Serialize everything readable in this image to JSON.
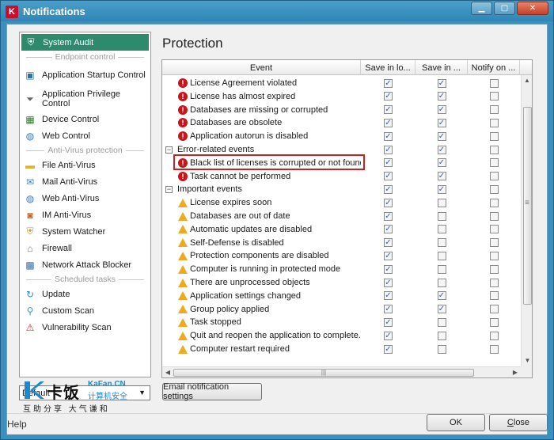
{
  "window": {
    "title": "Notifications",
    "controls": [
      "minimize",
      "maximize",
      "close"
    ]
  },
  "sidebar": {
    "items": [
      {
        "type": "item",
        "label": "System Audit",
        "icon": "shield-icon",
        "selected": true
      },
      {
        "type": "group",
        "label": "Endpoint control"
      },
      {
        "type": "item",
        "label": "Application Startup Control",
        "icon": "monitor-icon"
      },
      {
        "type": "item",
        "label": "Application Privilege Control",
        "icon": "filter-icon"
      },
      {
        "type": "item",
        "label": "Device Control",
        "icon": "chip-icon"
      },
      {
        "type": "item",
        "label": "Web Control",
        "icon": "globe-icon"
      },
      {
        "type": "group",
        "label": "Anti-Virus protection"
      },
      {
        "type": "item",
        "label": "File Anti-Virus",
        "icon": "folder-icon"
      },
      {
        "type": "item",
        "label": "Mail Anti-Virus",
        "icon": "envelope-icon"
      },
      {
        "type": "item",
        "label": "Web Anti-Virus",
        "icon": "globe-icon"
      },
      {
        "type": "item",
        "label": "IM Anti-Virus",
        "icon": "chat-icon"
      },
      {
        "type": "item",
        "label": "System Watcher",
        "icon": "shield-icon"
      },
      {
        "type": "item",
        "label": "Firewall",
        "icon": "firewall-icon"
      },
      {
        "type": "item",
        "label": "Network Attack Blocker",
        "icon": "network-icon"
      },
      {
        "type": "group",
        "label": "Scheduled tasks"
      },
      {
        "type": "item",
        "label": "Update",
        "icon": "update-icon"
      },
      {
        "type": "item",
        "label": "Custom Scan",
        "icon": "scan-icon"
      },
      {
        "type": "item",
        "label": "Vulnerability Scan",
        "icon": "vulnerability-icon"
      }
    ],
    "profile_select": "Default"
  },
  "main": {
    "title": "Protection",
    "columns": [
      "Event",
      "Save in lo...",
      "Save in ...",
      "Notify on ..."
    ],
    "rows": [
      {
        "type": "item",
        "sev": "critical",
        "label": "License Agreement violated",
        "c": [
          true,
          true,
          false
        ]
      },
      {
        "type": "item",
        "sev": "critical",
        "label": "License has almost expired",
        "c": [
          true,
          true,
          false
        ]
      },
      {
        "type": "item",
        "sev": "critical",
        "label": "Databases are missing or corrupted",
        "c": [
          true,
          true,
          false
        ]
      },
      {
        "type": "item",
        "sev": "critical",
        "label": "Databases are obsolete",
        "c": [
          true,
          true,
          false
        ]
      },
      {
        "type": "item",
        "sev": "critical",
        "label": "Application autorun is disabled",
        "c": [
          true,
          true,
          false
        ]
      },
      {
        "type": "group",
        "label": "Error-related events",
        "c": [
          true,
          true,
          false
        ]
      },
      {
        "type": "item",
        "sev": "critical",
        "label": "Black list of licenses is corrupted or not found",
        "c": [
          true,
          true,
          false
        ]
      },
      {
        "type": "item",
        "sev": "critical",
        "label": "Task cannot be performed",
        "c": [
          true,
          true,
          false
        ]
      },
      {
        "type": "group",
        "label": "Important events",
        "c": [
          true,
          true,
          false
        ]
      },
      {
        "type": "item",
        "sev": "warning",
        "label": "License expires soon",
        "c": [
          true,
          false,
          false
        ]
      },
      {
        "type": "item",
        "sev": "warning",
        "label": "Databases are out of date",
        "c": [
          true,
          false,
          false
        ]
      },
      {
        "type": "item",
        "sev": "warning",
        "label": "Automatic updates are disabled",
        "c": [
          true,
          false,
          false
        ]
      },
      {
        "type": "item",
        "sev": "warning",
        "label": "Self-Defense is disabled",
        "c": [
          true,
          false,
          false
        ]
      },
      {
        "type": "item",
        "sev": "warning",
        "label": "Protection components are disabled",
        "c": [
          true,
          false,
          false
        ]
      },
      {
        "type": "item",
        "sev": "warning",
        "label": "Computer is running in protected mode",
        "c": [
          true,
          false,
          false
        ]
      },
      {
        "type": "item",
        "sev": "warning",
        "label": "There are unprocessed objects",
        "c": [
          true,
          false,
          false
        ]
      },
      {
        "type": "item",
        "sev": "warning",
        "label": "Application settings changed",
        "c": [
          true,
          true,
          false
        ]
      },
      {
        "type": "item",
        "sev": "warning",
        "label": "Group policy applied",
        "c": [
          true,
          true,
          false
        ]
      },
      {
        "type": "item",
        "sev": "warning",
        "label": "Task stopped",
        "c": [
          true,
          false,
          false
        ]
      },
      {
        "type": "item",
        "sev": "warning",
        "label": "Quit and reopen the application to complete...",
        "c": [
          true,
          false,
          false
        ]
      },
      {
        "type": "item",
        "sev": "warning",
        "label": "Computer restart required",
        "c": [
          true,
          false,
          false
        ]
      }
    ],
    "email_button": "Email notification settings"
  },
  "footer": {
    "help": "Help",
    "ok": "OK",
    "close": "Close",
    "close_mnemonic": "C",
    "close_rest": "lose"
  },
  "watermark": {
    "brand_cn": "卡饭",
    "brand_en": "KaFan.CN",
    "sub_cn": "计算机安全",
    "line_cn": "互助分享  大气谦和"
  }
}
